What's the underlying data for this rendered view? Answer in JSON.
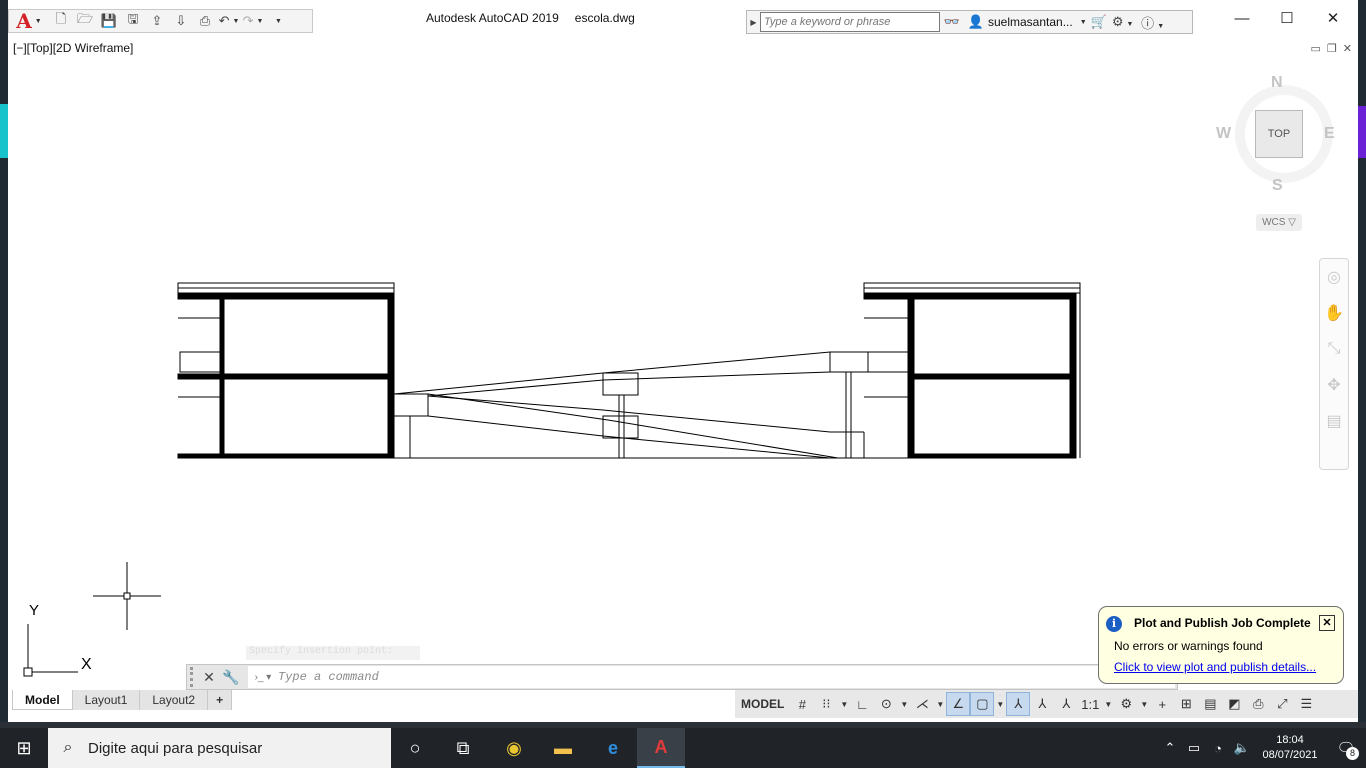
{
  "titlebar": {
    "app_title": "Autodesk AutoCAD 2019",
    "file_name": "escola.dwg",
    "search_placeholder": "Type a keyword or phrase",
    "user_name": "suelmasantan...",
    "app_logo": "A",
    "min_glyph": "—",
    "max_glyph": "☐",
    "close_glyph": "✕"
  },
  "qat_icons": [
    "new-icon",
    "open-icon",
    "save-icon",
    "saveas-icon",
    "cloud-open-icon",
    "cloud-save-icon",
    "plot-icon",
    "undo-icon",
    "redo-icon",
    "workspace-icon"
  ],
  "viewport": {
    "label": "[−][Top][2D Wireframe]",
    "ctrl_min": "▭",
    "ctrl_restore": "❐",
    "ctrl_close": "✕"
  },
  "viewcube": {
    "face": "TOP",
    "north": "N",
    "south": "S",
    "east": "E",
    "west": "W",
    "wcs": "WCS ▽"
  },
  "ucs": {
    "x_label": "X",
    "y_label": "Y"
  },
  "notification": {
    "title": "Plot and Publish Job Complete",
    "message": "No errors or warnings found",
    "link": "Click to view plot and publish details...",
    "close": "✕",
    "info": "i"
  },
  "command": {
    "history": "Specify insertion point:",
    "placeholder": "Type a command",
    "close": "✕",
    "settings": "🔧",
    "prompt": "›_ ▾",
    "expand": "▲"
  },
  "layout_tabs": [
    {
      "label": "Model",
      "active": true
    },
    {
      "label": "Layout1",
      "active": false
    },
    {
      "label": "Layout2",
      "active": false
    }
  ],
  "add_tab": "+",
  "statusbar": {
    "model": "MODEL",
    "scale": "1:1",
    "items": [
      "grid-icon",
      "snap-icon",
      "ortho-icon",
      "polar-icon",
      "isodraft-icon",
      "osnap-icon",
      "otrack-icon",
      "annotation-visibility-icon",
      "autoscale-icon",
      "annotation-scale-icon",
      "workspace-gear-icon",
      "add-icon",
      "isolate-icon",
      "quick-properties-icon",
      "graphics-icon",
      "plot-status-icon",
      "fullscreen-icon",
      "customize-icon"
    ]
  },
  "taskbar": {
    "search_placeholder": "Digite aqui para pesquisar",
    "time": "18:04",
    "date": "08/07/2021",
    "notif_count": "8",
    "apps": [
      "cortana-icon",
      "task-view-icon",
      "chrome-icon",
      "file-explorer-icon",
      "edge-icon",
      "autocad-icon"
    ]
  }
}
